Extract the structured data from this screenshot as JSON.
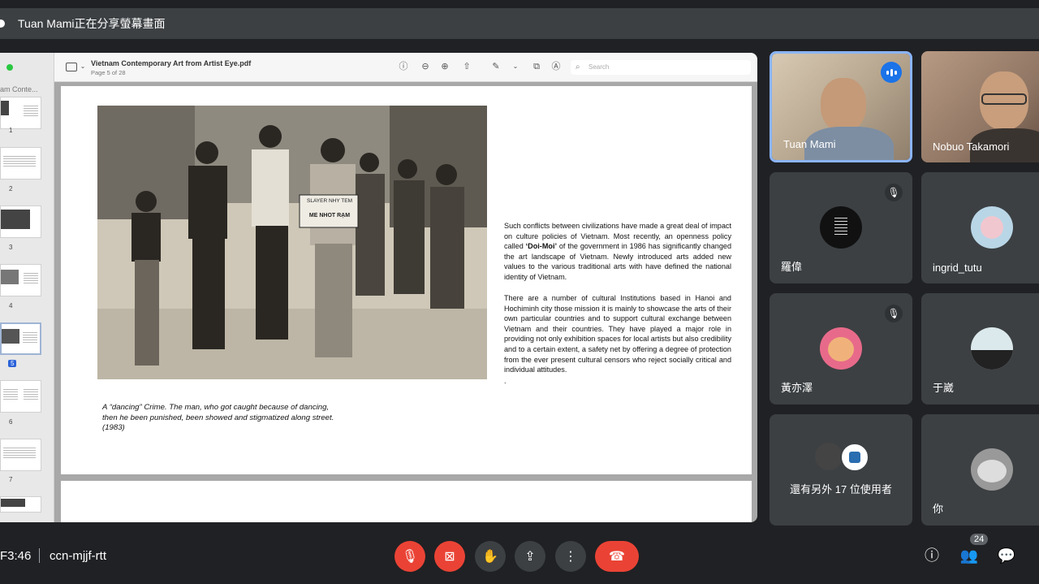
{
  "share_banner": {
    "text": "Tuan Mami正在分享螢幕畫面"
  },
  "pdf": {
    "filename": "Vietnam Contemporary Art from Artist Eye.pdf",
    "page_info": "Page 5 of 28",
    "search_placeholder": "Search",
    "sidebar_title": "am Conte...",
    "thumbnails": [
      {
        "num": "1",
        "selected": false
      },
      {
        "num": "2",
        "selected": false
      },
      {
        "num": "3",
        "selected": false
      },
      {
        "num": "4",
        "selected": false
      },
      {
        "num": "5",
        "selected": true
      },
      {
        "num": "6",
        "selected": false
      },
      {
        "num": "7",
        "selected": false
      }
    ],
    "photo_sign_1": "SLAYER NHY TEM",
    "photo_sign_2": "ME NHOT RẠM",
    "caption_1": "A “dancing” Crime. The man, who got caught because of dancing,",
    "caption_2": "then he been punished, been showed and stigmatized along street.",
    "caption_3": "(1983)",
    "para1_a": "Such conflicts between civilizations have made a great deal of impact on culture policies of Vietnam. Most recently, an openness policy called ",
    "para1_b": "‘Doi-Moi’",
    "para1_c": " of the government in 1986 has significantly changed the art landscape of Vietnam. Newly introduced arts added new values to the various traditional arts with have defined the national identity of Vietnam.",
    "para2": "There are a number of cultural Institutions based in Hanoi and Hochiminh city those mission it is mainly to showcase the arts of their own particular countries and to support cultural exchange between Vietnam and their countries. They have played a major role in providing not only exhibition spaces for local artists but also credibility and to a certain extent, a safety net by offering a degree of protection from the ever present cultural censors who reject socially critical and individual attitudes.",
    "para_dot": "."
  },
  "participants": [
    {
      "name": "Tuan Mami",
      "speaking": true
    },
    {
      "name": "Nobuo Takamori"
    },
    {
      "name": "羅偉",
      "muted": true
    },
    {
      "name": "ingrid_tutu"
    },
    {
      "name": "黃亦澤",
      "muted": true
    },
    {
      "name": "于崴"
    },
    {
      "name": "還有另外 17 位使用者"
    },
    {
      "name": "你"
    }
  ],
  "bottom": {
    "time": "F3:46",
    "meeting_code": "ccn-mjjf-rtt",
    "people_count": "24"
  },
  "colors": {
    "red": "#ea4335",
    "dark": "#202124",
    "tile": "#3c4043",
    "blue": "#1a73e8"
  }
}
